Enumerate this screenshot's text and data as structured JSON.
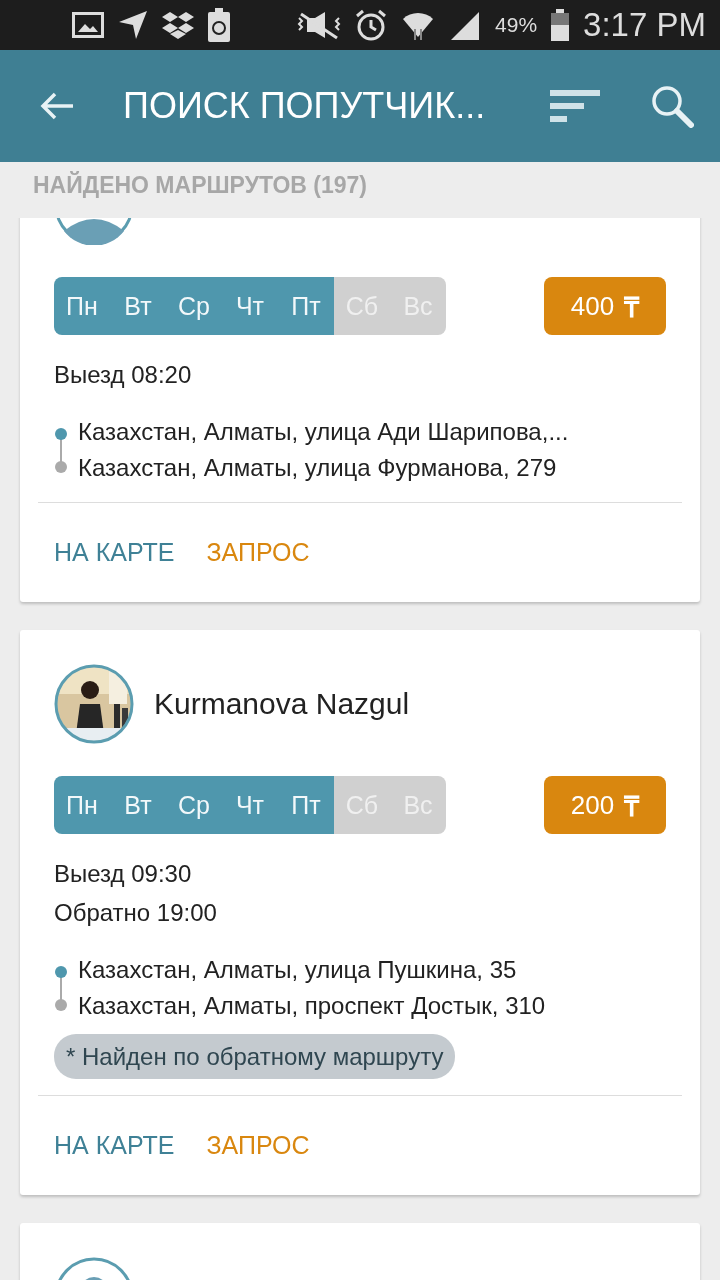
{
  "status_bar": {
    "battery": "49%",
    "time": "3:17 PM"
  },
  "app_bar": {
    "title": "ПОИСК ПОПУТЧИК..."
  },
  "list_header": "НАЙДЕНО МАРШРУТОВ (197)",
  "routes": [
    {
      "avatar": {
        "kind": "placeholder"
      },
      "days": [
        {
          "label": "Пн",
          "on": true
        },
        {
          "label": "Вт",
          "on": true
        },
        {
          "label": "Ср",
          "on": true
        },
        {
          "label": "Чт",
          "on": true
        },
        {
          "label": "Пт",
          "on": true
        },
        {
          "label": "Сб",
          "on": false
        },
        {
          "label": "Вс",
          "on": false
        }
      ],
      "price": "400",
      "currency": "₸",
      "times": [
        "Выезд 08:20"
      ],
      "from": "Казахстан, Алматы, улица Ади Шарипова,...",
      "to": "Казахстан, Алматы, улица Фурманова, 279",
      "actions": [
        {
          "label": "НА КАРТЕ",
          "kind": "map"
        },
        {
          "label": "ЗАПРОС",
          "kind": "request"
        }
      ]
    },
    {
      "avatar": {
        "kind": "picture"
      },
      "name": "Kurmanova Nazgul",
      "days": [
        {
          "label": "Пн",
          "on": true
        },
        {
          "label": "Вт",
          "on": true
        },
        {
          "label": "Ср",
          "on": true
        },
        {
          "label": "Чт",
          "on": true
        },
        {
          "label": "Пт",
          "on": true
        },
        {
          "label": "Сб",
          "on": false
        },
        {
          "label": "Вс",
          "on": false
        }
      ],
      "price": "200",
      "currency": "₸",
      "times": [
        "Выезд 09:30",
        "Обратно 19:00"
      ],
      "from": "Казахстан, Алматы, улица Пушкина, 35",
      "to": "Казахстан, Алматы, проспект Достык, 310",
      "note": "* Найден по обратному маршруту",
      "actions": [
        {
          "label": "НА КАРТЕ",
          "kind": "map"
        },
        {
          "label": "ЗАПРОС",
          "kind": "request"
        }
      ]
    },
    {
      "avatar": {
        "kind": "placeholder"
      }
    }
  ]
}
